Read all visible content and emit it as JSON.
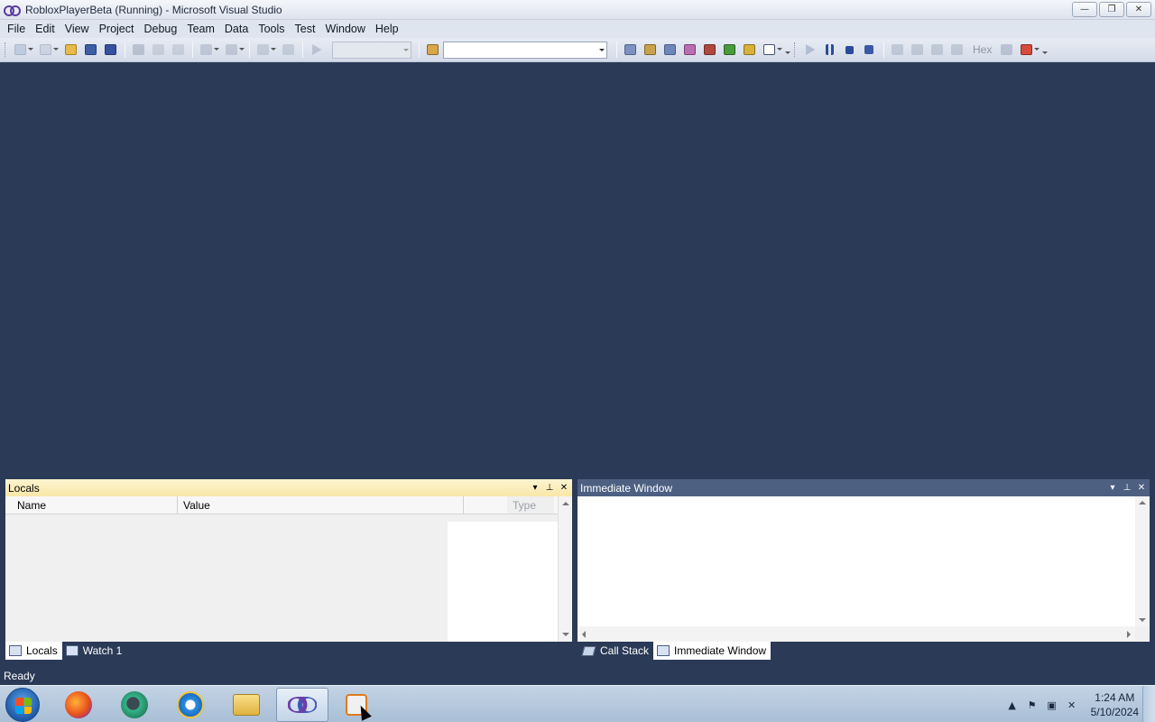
{
  "window": {
    "title": "RobloxPlayerBeta (Running) - Microsoft Visual Studio",
    "controls": {
      "minimize": "—",
      "restore": "❐",
      "close": "✕"
    }
  },
  "menu": [
    "File",
    "Edit",
    "View",
    "Project",
    "Debug",
    "Team",
    "Data",
    "Tools",
    "Test",
    "Window",
    "Help"
  ],
  "toolbar": {
    "solution_config_value": "",
    "find_value": "",
    "hex_label": "Hex"
  },
  "locals_panel": {
    "title": "Locals",
    "columns": [
      "Name",
      "Value",
      "Type"
    ],
    "rows": []
  },
  "immediate_panel": {
    "title": "Immediate Window",
    "content": ""
  },
  "left_tabs": [
    {
      "label": "Locals",
      "selected": true
    },
    {
      "label": "Watch 1",
      "selected": false
    }
  ],
  "right_tabs": [
    {
      "label": "Call Stack",
      "selected": false
    },
    {
      "label": "Immediate Window",
      "selected": true
    }
  ],
  "status": {
    "text": "Ready"
  },
  "taskbar": {
    "apps": [
      "firefox-icon",
      "app-green-icon",
      "internet-explorer-icon",
      "file-explorer-icon",
      "visual-studio-icon",
      "media-player-icon"
    ],
    "active_app": "visual-studio-icon",
    "clock": {
      "time": "1:24 AM",
      "date": "5/10/2024"
    }
  },
  "colors": {
    "ide_background": "#2b3a56",
    "active_panel_header": "#f9e7a9",
    "inactive_panel_header": "#4d6082"
  }
}
